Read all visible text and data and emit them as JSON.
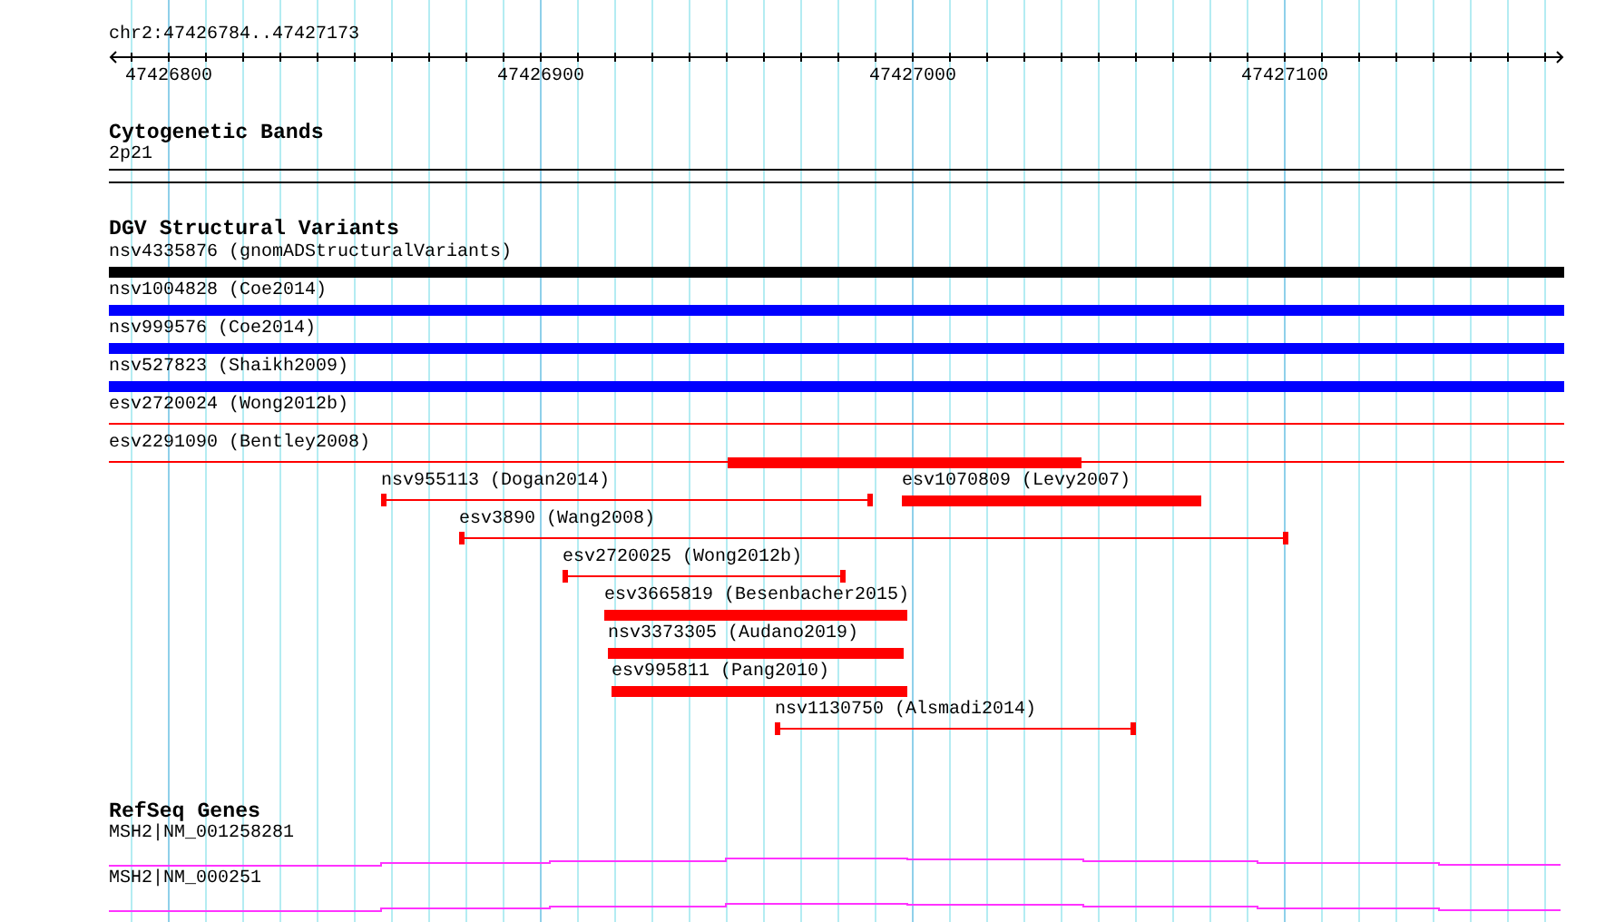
{
  "location": "chr2:47426784..47427173",
  "ruler": {
    "labels": [
      "47426800",
      "47426900",
      "47427000",
      "47427100"
    ]
  },
  "tracks": [
    {
      "kind": "cytoband",
      "title": "Cytogenetic Bands",
      "features": [
        {
          "label": "2p21"
        }
      ]
    },
    {
      "kind": "variants",
      "title": "DGV Structural Variants",
      "features": [
        {
          "label": "nsv4335876 (gnomADStructuralVariants)",
          "kind": "bar",
          "color": "#000000"
        },
        {
          "label": "nsv1004828 (Coe2014)",
          "kind": "bar",
          "color": "#0000ff"
        },
        {
          "label": "nsv999576 (Coe2014)",
          "kind": "bar",
          "color": "#0000ff"
        },
        {
          "label": "nsv527823 (Shaikh2009)",
          "kind": "bar",
          "color": "#0000ff"
        },
        {
          "label": "esv2720024 (Wong2012b)",
          "kind": "line",
          "color": "#ff0000"
        },
        {
          "label": "esv2291090 (Bentley2008)",
          "kind": "line",
          "color": "#ff0000"
        },
        {
          "kind": "bar",
          "color": "#ff0000"
        },
        {
          "label": "nsv955113 (Dogan2014)",
          "kind": "span",
          "color": "#ff0000"
        },
        {
          "label": "esv1070809 (Levy2007)",
          "kind": "bar",
          "color": "#ff0000"
        },
        {
          "label": "esv3890 (Wang2008)",
          "kind": "span",
          "color": "#ff0000"
        },
        {
          "label": "esv2720025 (Wong2012b)",
          "kind": "span",
          "color": "#ff0000"
        },
        {
          "label": "esv3665819 (Besenbacher2015)",
          "kind": "bar",
          "color": "#ff0000"
        },
        {
          "label": "nsv3373305 (Audano2019)",
          "kind": "bar",
          "color": "#ff0000"
        },
        {
          "label": "esv995811 (Pang2010)",
          "kind": "bar",
          "color": "#ff0000"
        },
        {
          "label": "nsv1130750 (Alsmadi2014)",
          "kind": "span",
          "color": "#ff0000"
        }
      ]
    },
    {
      "kind": "genes",
      "title": "RefSeq Genes",
      "features": [
        {
          "label": "MSH2|NM_001258281"
        },
        {
          "label": "MSH2|NM_000251"
        }
      ]
    }
  ]
}
